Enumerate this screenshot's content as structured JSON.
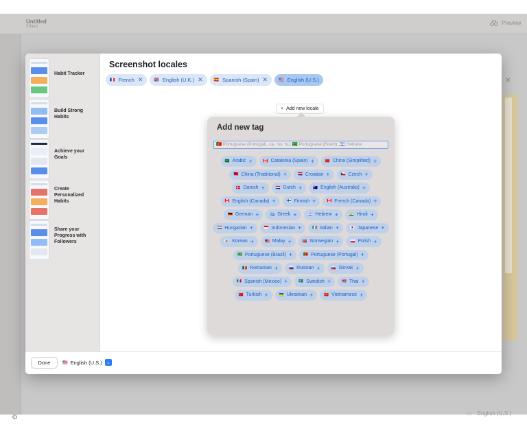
{
  "background_app": {
    "title": "Untitled",
    "subtitle": "Edited",
    "preview_label": "Preview",
    "footer_locale": "English (U.S.)"
  },
  "sheet": {
    "title": "Screenshot locales",
    "selected_locales": [
      {
        "flag": "🇫🇷",
        "label": "French"
      },
      {
        "flag": "🇬🇧",
        "label": "English (U.K.)"
      },
      {
        "flag": "🇪🇸",
        "label": "Spanish (Spain)"
      },
      {
        "flag": "🇺🇸",
        "label": "English (U.S.)"
      }
    ],
    "add_locale_label": "Add new locale",
    "done_label": "Done",
    "current_locale": {
      "flag": "🇺🇸",
      "label": "English (U.S.)"
    }
  },
  "screenshots": [
    {
      "label": "Habit Tracker",
      "accent": "#f2a23c"
    },
    {
      "label": "Build Strong Habits",
      "accent": "#3d7be8"
    },
    {
      "label": "Achieve your Goals",
      "accent": "#1f2a44"
    },
    {
      "label": "Create Personalized Habits",
      "accent": "#e45a4f"
    },
    {
      "label": "Share your Progress with Followers",
      "accent": "#3d7be8"
    }
  ],
  "add_tag": {
    "title": "Add new tag",
    "input_value": "🇵🇹 Portuguese (Portugal), ca, ms, hu, 🇧🇷 Portuguese (Brazil), 🇮🇱 Hebrew",
    "tags": [
      {
        "flag": "🇸🇦",
        "label": "Arabic"
      },
      {
        "flag": "🇨🇦",
        "label": "Catalonia (Spain)"
      },
      {
        "flag": "🇨🇳",
        "label": "China (Simplified)"
      },
      {
        "flag": "🇹🇼",
        "label": "China (Traditional)"
      },
      {
        "flag": "🇭🇷",
        "label": "Croatian"
      },
      {
        "flag": "🇨🇿",
        "label": "Czech"
      },
      {
        "flag": "🇩🇰",
        "label": "Danish"
      },
      {
        "flag": "🇳🇱",
        "label": "Dutch"
      },
      {
        "flag": "🇦🇺",
        "label": "English (Australia)"
      },
      {
        "flag": "🇨🇦",
        "label": "English (Canada)"
      },
      {
        "flag": "🇫🇮",
        "label": "Finnish"
      },
      {
        "flag": "🇨🇦",
        "label": "French (Canada)"
      },
      {
        "flag": "🇩🇪",
        "label": "German"
      },
      {
        "flag": "🇬🇷",
        "label": "Greek"
      },
      {
        "flag": "🇮🇱",
        "label": "Hebrew"
      },
      {
        "flag": "🇮🇳",
        "label": "Hindi"
      },
      {
        "flag": "🇭🇺",
        "label": "Hungarian"
      },
      {
        "flag": "🇮🇩",
        "label": "Indonesian"
      },
      {
        "flag": "🇮🇹",
        "label": "Italian"
      },
      {
        "flag": "🇯🇵",
        "label": "Japanese"
      },
      {
        "flag": "🇰🇷",
        "label": "Korean"
      },
      {
        "flag": "🇲🇾",
        "label": "Malay"
      },
      {
        "flag": "🇳🇴",
        "label": "Norwegian"
      },
      {
        "flag": "🇵🇱",
        "label": "Polish"
      },
      {
        "flag": "🇧🇷",
        "label": "Portuguese (Brazil)"
      },
      {
        "flag": "🇵🇹",
        "label": "Portuguese (Portugal)"
      },
      {
        "flag": "🇷🇴",
        "label": "Romanian"
      },
      {
        "flag": "🇷🇺",
        "label": "Russian"
      },
      {
        "flag": "🇸🇰",
        "label": "Slovak"
      },
      {
        "flag": "🇲🇽",
        "label": "Spanish (Mexico)"
      },
      {
        "flag": "🇸🇪",
        "label": "Swedish"
      },
      {
        "flag": "🇹🇭",
        "label": "Thai"
      },
      {
        "flag": "🇹🇷",
        "label": "Turkish"
      },
      {
        "flag": "🇺🇦",
        "label": "Ukrainian"
      },
      {
        "flag": "🇻🇳",
        "label": "Vietnamese"
      }
    ]
  }
}
